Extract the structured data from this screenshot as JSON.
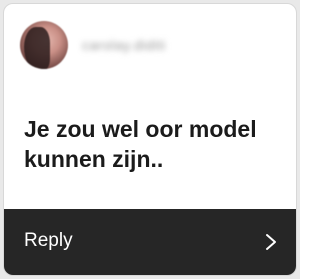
{
  "header": {
    "username": "carolay.diditi"
  },
  "message": {
    "text": "Je zou wel oor model kunnen zijn.."
  },
  "footer": {
    "reply_label": "Reply",
    "chevron_icon": "chevron-right-icon"
  },
  "colors": {
    "card_background": "#ffffff",
    "footer_background": "#262626",
    "message_text": "#1b1b1b",
    "reply_text": "#ffffff"
  }
}
